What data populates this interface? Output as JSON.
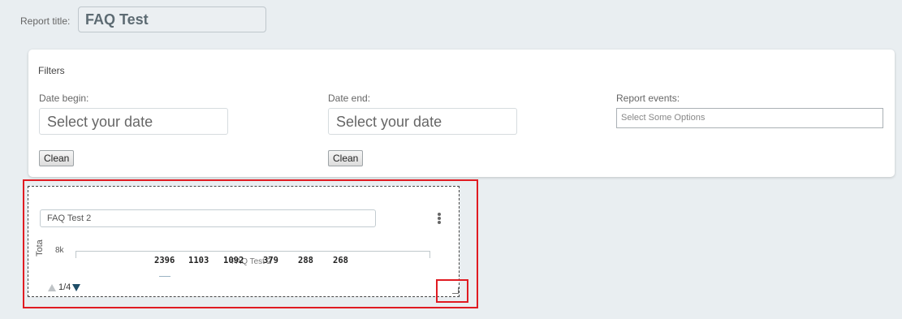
{
  "report": {
    "title_label": "Report title:",
    "title_value": "FAQ Test"
  },
  "filters": {
    "heading": "Filters",
    "date_begin": {
      "label": "Date begin:",
      "placeholder": "Select your date",
      "clean_label": "Clean"
    },
    "date_end": {
      "label": "Date end:",
      "placeholder": "Select your date",
      "clean_label": "Clean"
    },
    "report_events": {
      "label": "Report events:",
      "placeholder": "Select Some Options"
    }
  },
  "widget": {
    "title_value": "FAQ Test 2",
    "menu_icon": "kebab-vertical-icon",
    "pager": {
      "current": "1",
      "separator": "/",
      "total": "4",
      "text": "1/4"
    }
  },
  "chart_data": {
    "type": "bar",
    "ylabel": "Tota",
    "y_ticks": [
      "8k"
    ],
    "series": [
      {
        "name": "FAQ Test 2",
        "values": [
          2396,
          1103,
          1092,
          379,
          288,
          268
        ]
      }
    ],
    "data_labels": [
      "2396",
      "1103",
      "1092",
      "379",
      "288",
      "268"
    ]
  },
  "colors": {
    "background": "#e9eef1",
    "highlight": "#e01b22",
    "pager_active": "#1f4e68",
    "pager_inactive": "#bfc3c6"
  }
}
